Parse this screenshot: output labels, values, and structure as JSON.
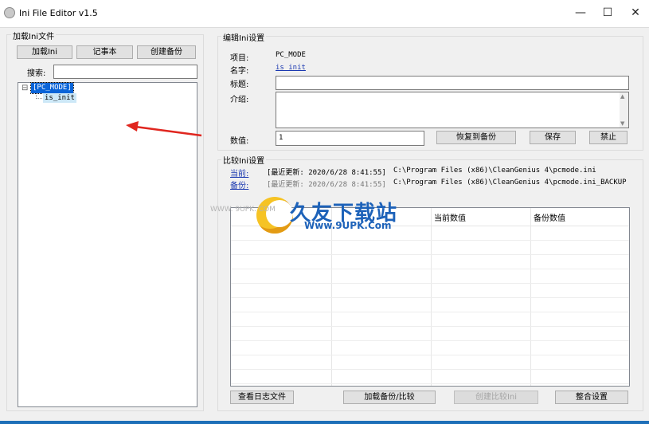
{
  "window": {
    "title": "Ini File Editor v1.5",
    "minimize": "—",
    "maximize": "☐",
    "close": "✕"
  },
  "load_group": {
    "title": "加载Ini文件",
    "load_button": "加载Ini",
    "notepad_button": "记事本",
    "backup_button": "创建备份",
    "search_label": "搜索:",
    "search_value": ""
  },
  "tree": {
    "expander": "⊟",
    "root": "[PC_MODE]",
    "child": "is_init"
  },
  "edit_group": {
    "title": "编辑Ini设置",
    "item_label": "项目:",
    "item_value": "PC_MODE",
    "name_label": "名字:",
    "name_value": "is_init",
    "heading_label": "标题:",
    "heading_value": "",
    "intro_label": "介绍:",
    "intro_value": "",
    "value_label": "数值:",
    "value_value": "1",
    "restore_button": "恢复到备份",
    "save_button": "保存",
    "disable_button": "禁止"
  },
  "compare_group": {
    "title": "比较Ini设置",
    "current_link": "当前:",
    "current_updated": "[最近更新: 2020/6/28 8:41:55]",
    "current_path": "C:\\Program Files (x86)\\CleanGenius 4\\pcmode.ini",
    "backup_link": "备份:",
    "backup_updated": "[最近更新: 2020/6/28 8:41:55]",
    "backup_path": "C:\\Program Files (x86)\\CleanGenius 4\\pcmode.ini_BACKUP",
    "columns": [
      "",
      "",
      "当前数值",
      "备份数值"
    ],
    "log_button": "查看日志文件",
    "load_compare_button": "加载备份/比较",
    "create_compare_button": "创建比较Ini",
    "merge_button": "整合设置"
  },
  "watermark": {
    "brand": "久友下载站",
    "url": "Www.9UPK.Com",
    "url_left": "WWW. 9UPK. COM"
  },
  "colors": {
    "tree_selection": "#0a64d8",
    "link": "#1a38b0",
    "arrow": "#e0261f",
    "watermark": "#1d62b9"
  }
}
